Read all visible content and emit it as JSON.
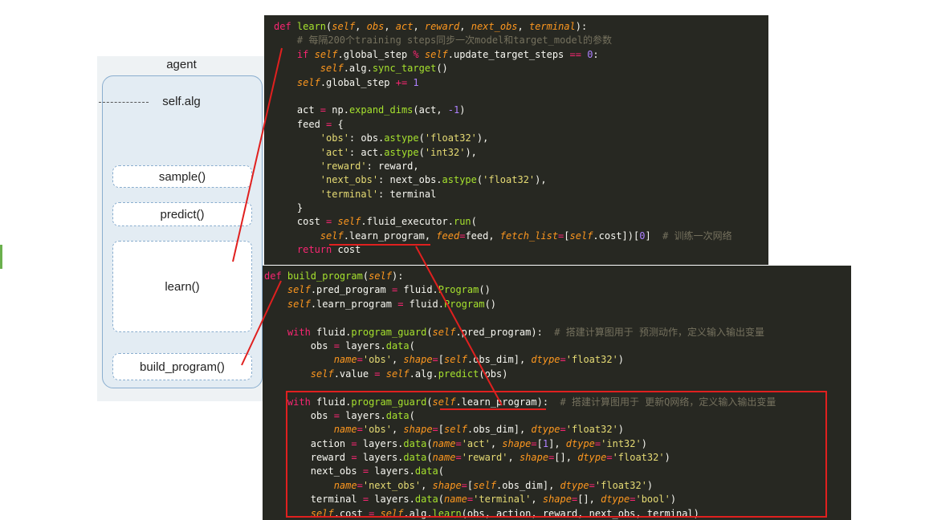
{
  "diagram": {
    "agent_label": "agent",
    "alg_label": "self.alg",
    "methods": [
      "sample()",
      "predict()",
      "learn()",
      "build_program()"
    ]
  },
  "code_learn": [
    [
      [
        "kw",
        "def "
      ],
      [
        "fn",
        "learn"
      ],
      [
        "t",
        "("
      ],
      [
        "slf",
        "self"
      ],
      [
        "t",
        ", "
      ],
      [
        "arg",
        "obs"
      ],
      [
        "t",
        ", "
      ],
      [
        "arg",
        "act"
      ],
      [
        "t",
        ", "
      ],
      [
        "arg",
        "reward"
      ],
      [
        "t",
        ", "
      ],
      [
        "arg",
        "next_obs"
      ],
      [
        "t",
        ", "
      ],
      [
        "arg",
        "terminal"
      ],
      [
        "t",
        "):"
      ]
    ],
    [
      [
        "t",
        "    "
      ],
      [
        "cm",
        "# 每隔200个training steps同步一次model和target_model的参数"
      ]
    ],
    [
      [
        "t",
        "    "
      ],
      [
        "kw",
        "if "
      ],
      [
        "slf",
        "self"
      ],
      [
        "t",
        ".global_step "
      ],
      [
        "kw",
        "% "
      ],
      [
        "slf",
        "self"
      ],
      [
        "t",
        ".update_target_steps "
      ],
      [
        "kw",
        "== "
      ],
      [
        "num",
        "0"
      ],
      [
        "t",
        ":"
      ]
    ],
    [
      [
        "t",
        "        "
      ],
      [
        "slf",
        "self"
      ],
      [
        "t",
        ".alg."
      ],
      [
        "fn",
        "sync_target"
      ],
      [
        "t",
        "()"
      ]
    ],
    [
      [
        "t",
        "    "
      ],
      [
        "slf",
        "self"
      ],
      [
        "t",
        ".global_step "
      ],
      [
        "kw",
        "+= "
      ],
      [
        "num",
        "1"
      ]
    ],
    [
      [
        "t",
        ""
      ]
    ],
    [
      [
        "t",
        "    act "
      ],
      [
        "kw",
        "= "
      ],
      [
        "t",
        "np."
      ],
      [
        "fn",
        "expand_dims"
      ],
      [
        "t",
        "(act, "
      ],
      [
        "num",
        "-1"
      ],
      [
        "t",
        ")"
      ]
    ],
    [
      [
        "t",
        "    feed "
      ],
      [
        "kw",
        "= "
      ],
      [
        "t",
        "{"
      ]
    ],
    [
      [
        "t",
        "        "
      ],
      [
        "str",
        "'obs'"
      ],
      [
        "t",
        ": obs."
      ],
      [
        "fn",
        "astype"
      ],
      [
        "t",
        "("
      ],
      [
        "str",
        "'float32'"
      ],
      [
        "t",
        "),"
      ]
    ],
    [
      [
        "t",
        "        "
      ],
      [
        "str",
        "'act'"
      ],
      [
        "t",
        ": act."
      ],
      [
        "fn",
        "astype"
      ],
      [
        "t",
        "("
      ],
      [
        "str",
        "'int32'"
      ],
      [
        "t",
        "),"
      ]
    ],
    [
      [
        "t",
        "        "
      ],
      [
        "str",
        "'reward'"
      ],
      [
        "t",
        ": reward,"
      ]
    ],
    [
      [
        "t",
        "        "
      ],
      [
        "str",
        "'next_obs'"
      ],
      [
        "t",
        ": next_obs."
      ],
      [
        "fn",
        "astype"
      ],
      [
        "t",
        "("
      ],
      [
        "str",
        "'float32'"
      ],
      [
        "t",
        "),"
      ]
    ],
    [
      [
        "t",
        "        "
      ],
      [
        "str",
        "'terminal'"
      ],
      [
        "t",
        ": terminal"
      ]
    ],
    [
      [
        "t",
        "    }"
      ]
    ],
    [
      [
        "t",
        "    cost "
      ],
      [
        "kw",
        "= "
      ],
      [
        "slf",
        "self"
      ],
      [
        "t",
        ".fluid_executor."
      ],
      [
        "fn",
        "run"
      ],
      [
        "t",
        "("
      ]
    ],
    [
      [
        "t",
        "        "
      ],
      [
        "slf",
        "self"
      ],
      [
        "t",
        ".learn_program, "
      ],
      [
        "arg",
        "feed"
      ],
      [
        "kw",
        "="
      ],
      [
        "t",
        "feed, "
      ],
      [
        "arg",
        "fetch_list"
      ],
      [
        "kw",
        "="
      ],
      [
        "t",
        "["
      ],
      [
        "slf",
        "self"
      ],
      [
        "t",
        ".cost])["
      ],
      [
        "num",
        "0"
      ],
      [
        "t",
        "]  "
      ],
      [
        "cm",
        "# 训练一次网络"
      ]
    ],
    [
      [
        "t",
        "    "
      ],
      [
        "kw",
        "return "
      ],
      [
        "t",
        "cost"
      ]
    ]
  ],
  "code_build": [
    [
      [
        "kw",
        "def "
      ],
      [
        "fn",
        "build_program"
      ],
      [
        "t",
        "("
      ],
      [
        "slf",
        "self"
      ],
      [
        "t",
        "):"
      ]
    ],
    [
      [
        "t",
        "    "
      ],
      [
        "slf",
        "self"
      ],
      [
        "t",
        ".pred_program "
      ],
      [
        "kw",
        "= "
      ],
      [
        "t",
        "fluid."
      ],
      [
        "fn",
        "Program"
      ],
      [
        "t",
        "()"
      ]
    ],
    [
      [
        "t",
        "    "
      ],
      [
        "slf",
        "self"
      ],
      [
        "t",
        ".learn_program "
      ],
      [
        "kw",
        "= "
      ],
      [
        "t",
        "fluid."
      ],
      [
        "fn",
        "Program"
      ],
      [
        "t",
        "()"
      ]
    ],
    [
      [
        "t",
        ""
      ]
    ],
    [
      [
        "t",
        "    "
      ],
      [
        "kw",
        "with "
      ],
      [
        "t",
        "fluid."
      ],
      [
        "fn",
        "program_guard"
      ],
      [
        "t",
        "("
      ],
      [
        "slf",
        "self"
      ],
      [
        "t",
        ".pred_program):  "
      ],
      [
        "cm",
        "# 搭建计算图用于 预测动作，定义输入输出变量"
      ]
    ],
    [
      [
        "t",
        "        obs "
      ],
      [
        "kw",
        "= "
      ],
      [
        "t",
        "layers."
      ],
      [
        "fn",
        "data"
      ],
      [
        "t",
        "("
      ]
    ],
    [
      [
        "t",
        "            "
      ],
      [
        "arg",
        "name"
      ],
      [
        "kw",
        "="
      ],
      [
        "str",
        "'obs'"
      ],
      [
        "t",
        ", "
      ],
      [
        "arg",
        "shape"
      ],
      [
        "kw",
        "="
      ],
      [
        "t",
        "["
      ],
      [
        "slf",
        "self"
      ],
      [
        "t",
        ".obs_dim], "
      ],
      [
        "arg",
        "dtype"
      ],
      [
        "kw",
        "="
      ],
      [
        "str",
        "'float32'"
      ],
      [
        "t",
        ")"
      ]
    ],
    [
      [
        "t",
        "        "
      ],
      [
        "slf",
        "self"
      ],
      [
        "t",
        ".value "
      ],
      [
        "kw",
        "= "
      ],
      [
        "slf",
        "self"
      ],
      [
        "t",
        ".alg."
      ],
      [
        "fn",
        "predict"
      ],
      [
        "t",
        "(obs)"
      ]
    ],
    [
      [
        "t",
        ""
      ]
    ],
    [
      [
        "t",
        "    "
      ],
      [
        "kw",
        "with "
      ],
      [
        "t",
        "fluid."
      ],
      [
        "fn",
        "program_guard"
      ],
      [
        "t",
        "("
      ],
      [
        "slf",
        "self"
      ],
      [
        "t",
        ".learn_program):  "
      ],
      [
        "cm",
        "# 搭建计算图用于 更新Q网络，定义输入输出变量"
      ]
    ],
    [
      [
        "t",
        "        obs "
      ],
      [
        "kw",
        "= "
      ],
      [
        "t",
        "layers."
      ],
      [
        "fn",
        "data"
      ],
      [
        "t",
        "("
      ]
    ],
    [
      [
        "t",
        "            "
      ],
      [
        "arg",
        "name"
      ],
      [
        "kw",
        "="
      ],
      [
        "str",
        "'obs'"
      ],
      [
        "t",
        ", "
      ],
      [
        "arg",
        "shape"
      ],
      [
        "kw",
        "="
      ],
      [
        "t",
        "["
      ],
      [
        "slf",
        "self"
      ],
      [
        "t",
        ".obs_dim], "
      ],
      [
        "arg",
        "dtype"
      ],
      [
        "kw",
        "="
      ],
      [
        "str",
        "'float32'"
      ],
      [
        "t",
        ")"
      ]
    ],
    [
      [
        "t",
        "        action "
      ],
      [
        "kw",
        "= "
      ],
      [
        "t",
        "layers."
      ],
      [
        "fn",
        "data"
      ],
      [
        "t",
        "("
      ],
      [
        "arg",
        "name"
      ],
      [
        "kw",
        "="
      ],
      [
        "str",
        "'act'"
      ],
      [
        "t",
        ", "
      ],
      [
        "arg",
        "shape"
      ],
      [
        "kw",
        "="
      ],
      [
        "t",
        "["
      ],
      [
        "num",
        "1"
      ],
      [
        "t",
        "], "
      ],
      [
        "arg",
        "dtype"
      ],
      [
        "kw",
        "="
      ],
      [
        "str",
        "'int32'"
      ],
      [
        "t",
        ")"
      ]
    ],
    [
      [
        "t",
        "        reward "
      ],
      [
        "kw",
        "= "
      ],
      [
        "t",
        "layers."
      ],
      [
        "fn",
        "data"
      ],
      [
        "t",
        "("
      ],
      [
        "arg",
        "name"
      ],
      [
        "kw",
        "="
      ],
      [
        "str",
        "'reward'"
      ],
      [
        "t",
        ", "
      ],
      [
        "arg",
        "shape"
      ],
      [
        "kw",
        "="
      ],
      [
        "t",
        "[], "
      ],
      [
        "arg",
        "dtype"
      ],
      [
        "kw",
        "="
      ],
      [
        "str",
        "'float32'"
      ],
      [
        "t",
        ")"
      ]
    ],
    [
      [
        "t",
        "        next_obs "
      ],
      [
        "kw",
        "= "
      ],
      [
        "t",
        "layers."
      ],
      [
        "fn",
        "data"
      ],
      [
        "t",
        "("
      ]
    ],
    [
      [
        "t",
        "            "
      ],
      [
        "arg",
        "name"
      ],
      [
        "kw",
        "="
      ],
      [
        "str",
        "'next_obs'"
      ],
      [
        "t",
        ", "
      ],
      [
        "arg",
        "shape"
      ],
      [
        "kw",
        "="
      ],
      [
        "t",
        "["
      ],
      [
        "slf",
        "self"
      ],
      [
        "t",
        ".obs_dim], "
      ],
      [
        "arg",
        "dtype"
      ],
      [
        "kw",
        "="
      ],
      [
        "str",
        "'float32'"
      ],
      [
        "t",
        ")"
      ]
    ],
    [
      [
        "t",
        "        terminal "
      ],
      [
        "kw",
        "= "
      ],
      [
        "t",
        "layers."
      ],
      [
        "fn",
        "data"
      ],
      [
        "t",
        "("
      ],
      [
        "arg",
        "name"
      ],
      [
        "kw",
        "="
      ],
      [
        "str",
        "'terminal'"
      ],
      [
        "t",
        ", "
      ],
      [
        "arg",
        "shape"
      ],
      [
        "kw",
        "="
      ],
      [
        "t",
        "[], "
      ],
      [
        "arg",
        "dtype"
      ],
      [
        "kw",
        "="
      ],
      [
        "str",
        "'bool'"
      ],
      [
        "t",
        ")"
      ]
    ],
    [
      [
        "t",
        "        "
      ],
      [
        "slf",
        "self"
      ],
      [
        "t",
        ".cost "
      ],
      [
        "kw",
        "= "
      ],
      [
        "slf",
        "self"
      ],
      [
        "t",
        ".alg."
      ],
      [
        "fn",
        "learn"
      ],
      [
        "t",
        "(obs, action, reward, next_obs, terminal)"
      ]
    ]
  ],
  "colors": {
    "code_bg": "#272822",
    "annotation_red": "#e0201f",
    "agent_border": "#8aaecf"
  }
}
